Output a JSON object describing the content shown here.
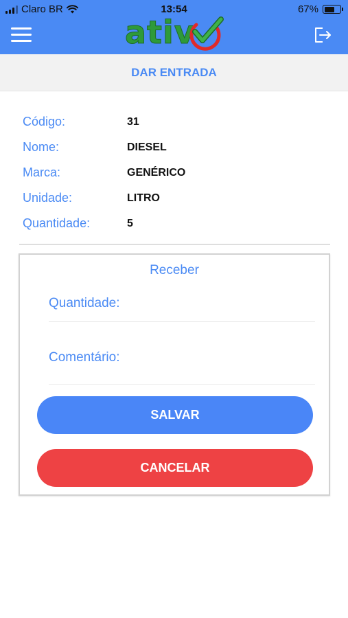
{
  "status_bar": {
    "carrier": "Claro BR",
    "time": "13:54",
    "battery_percent": "67%",
    "battery_level": 0.67
  },
  "header": {
    "logo_text": "ativ",
    "menu_icon": "hamburger-menu-icon",
    "logout_icon": "logout-icon",
    "colors": {
      "header_bg": "#4a8af4",
      "logo_green": "#2e9a3a",
      "logo_red": "#e02a2a"
    }
  },
  "page": {
    "title": "DAR ENTRADA"
  },
  "product": {
    "rows": [
      {
        "label": "Código:",
        "value": "31"
      },
      {
        "label": "Nome:",
        "value": "DIESEL"
      },
      {
        "label": "Marca:",
        "value": "GENÉRICO"
      },
      {
        "label": "Unidade:",
        "value": "LITRO"
      },
      {
        "label": "Quantidade:",
        "value": "5"
      }
    ]
  },
  "receive_form": {
    "title": "Receber",
    "quantity_label": "Quantidade:",
    "quantity_value": "",
    "comment_label": "Comentário:",
    "comment_value": "",
    "save_label": "SALVAR",
    "cancel_label": "CANCELAR",
    "colors": {
      "accent": "#4a8af4",
      "save": "#4a86f7",
      "cancel": "#ee4244"
    }
  }
}
